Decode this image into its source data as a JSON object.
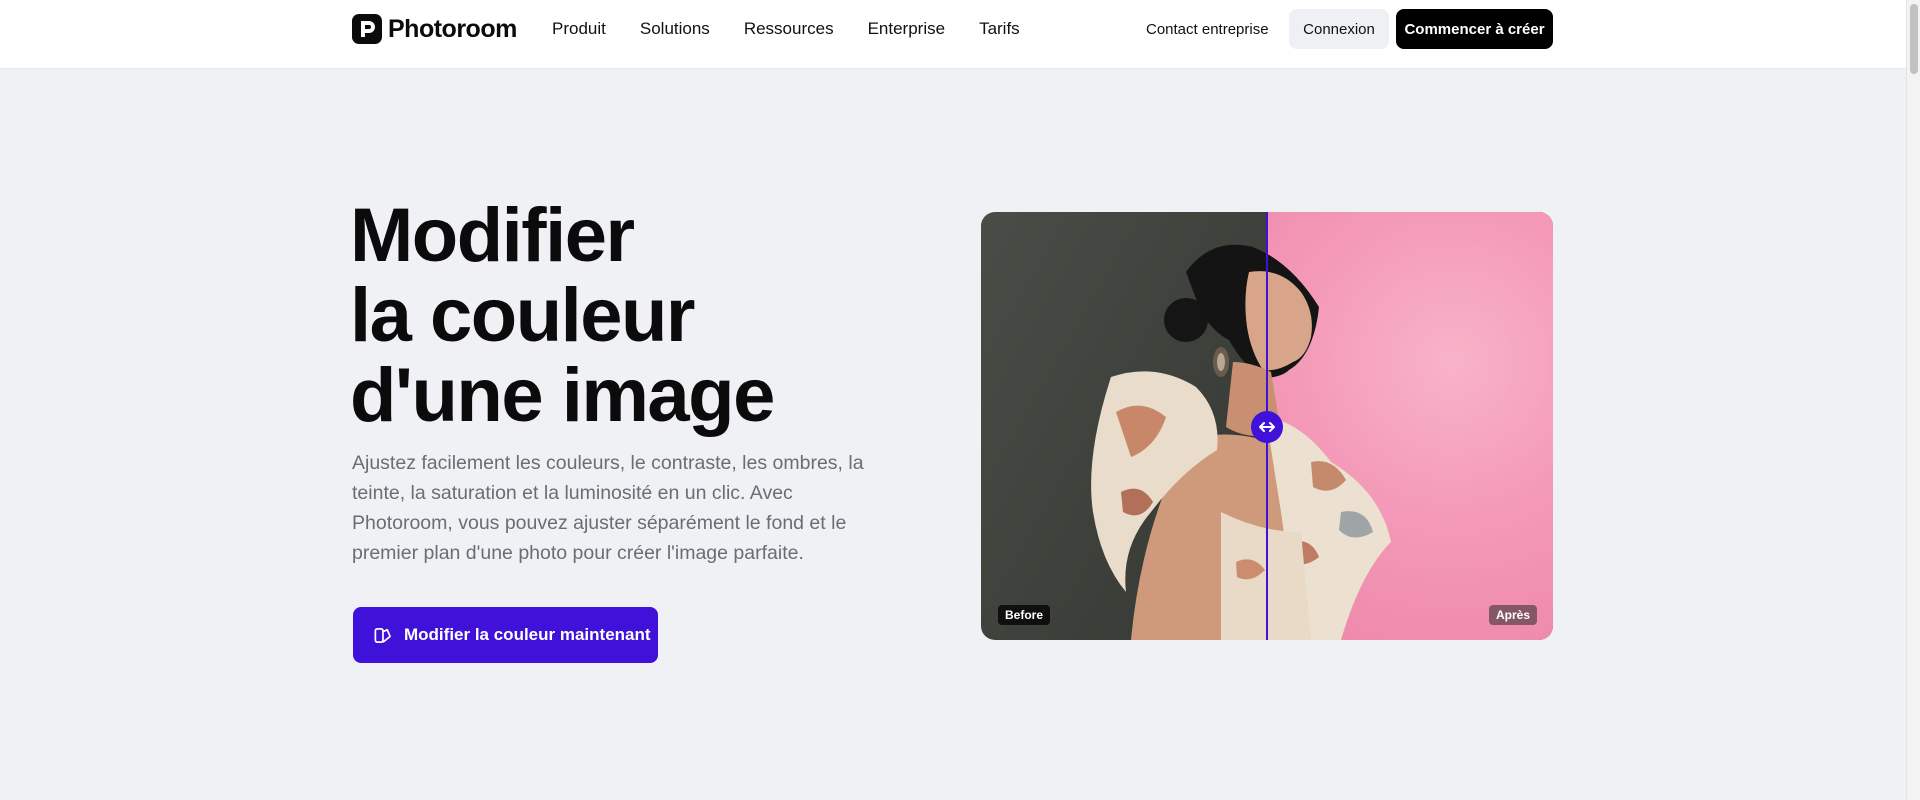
{
  "header": {
    "brand": "Photoroom",
    "nav": [
      "Produit",
      "Solutions",
      "Ressources",
      "Enterprise",
      "Tarifs"
    ],
    "contact": "Contact entreprise",
    "login": "Connexion",
    "start": "Commencer à créer"
  },
  "hero": {
    "title_lines": [
      "Modifier",
      "la couleur",
      "d'une image"
    ],
    "description": "Ajustez facilement les couleurs, le contraste, les ombres, la teinte, la saturation et la luminosité en un clic. Avec Photoroom, vous pouvez ajuster séparément le fond et le premier plan d'une photo pour créer l'image parfaite.",
    "cta": "Modifier la couleur maintenant"
  },
  "compare": {
    "before_label": "Before",
    "after_label": "Après",
    "position_percent": 50
  },
  "colors": {
    "accent": "#3f11d9",
    "background": "#f0f1f5",
    "after_bg": "#f49ab9"
  },
  "icons": {
    "brand": "photoroom-logo-icon",
    "cta": "edit-image-icon",
    "handle": "double-arrow-icon"
  }
}
